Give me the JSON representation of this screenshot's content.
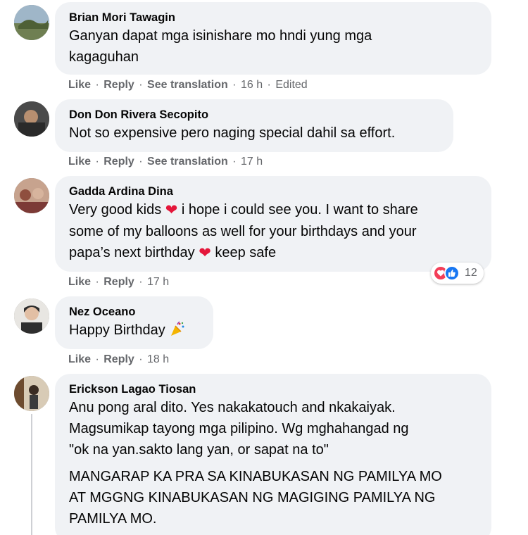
{
  "comments": [
    {
      "author": "Brian Mori Tawagin",
      "text": "Ganyan dapat mga isinishare mo hndi yung mga\nkagaguhan",
      "like": "Like",
      "reply": "Reply",
      "translate": "See translation",
      "time": "16 h",
      "edited": "Edited"
    },
    {
      "author": "Don Don Rivera Secopito",
      "text": "Not so expensive pero naging special dahil sa effort.",
      "like": "Like",
      "reply": "Reply",
      "translate": "See translation",
      "time": "17 h"
    },
    {
      "author": "Gadda Ardina Dina",
      "text_a": "Very good kids",
      "text_b": " i hope i could see you. I want to share\nsome of my balloons as well for your birthdays and your\npapa’s next birthday",
      "text_c": " keep safe",
      "like": "Like",
      "reply": "Reply",
      "time": "17 h",
      "reaction_count": "12"
    },
    {
      "author": "Nez Oceano",
      "text": "Happy Birthday",
      "like": "Like",
      "reply": "Reply",
      "time": "18 h"
    },
    {
      "author": "Erickson Lagao Tiosan",
      "text": "Anu pong aral dito. Yes nakakatouch and nkakaiyak.\nMagsumikap tayong mga pilipino. Wg mghahangad ng\n\"ok na yan.sakto lang yan, or sapat na to\"",
      "text2": "MANGARAP KA PRA SA KINABUKASAN NG PAMILYA MO\nAT MGGNG KINABUKASAN NG MAGIGING PAMILYA NG\nPAMILYA MO."
    }
  ],
  "colors": {
    "bubble": "#f0f2f5",
    "meta": "#65676b",
    "love": "#f33e58",
    "like": "#1877f2"
  },
  "icons": [
    "heart-emoji-icon",
    "party-popper-icon",
    "love-reaction-icon",
    "like-reaction-icon"
  ]
}
